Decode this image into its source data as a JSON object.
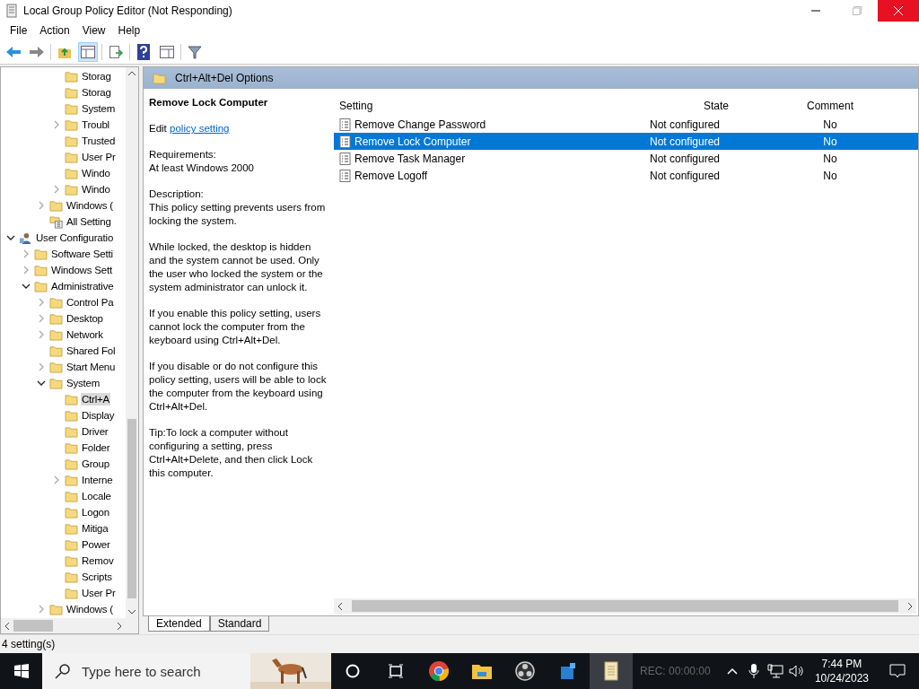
{
  "window": {
    "title": "Local Group Policy Editor (Not Responding)"
  },
  "menu": [
    "File",
    "Action",
    "View",
    "Help"
  ],
  "tree": {
    "items": [
      {
        "children": [
          {
            "children": [
              {
                "children": [
                  {
                    "label": "Storag",
                    "selected": false
                  },
                  {
                    "label": "Storag",
                    "selected": false
                  },
                  {
                    "label": "System",
                    "selected": false
                  },
                  {
                    "label": "Troubl",
                    "expanded": false,
                    "selected": false
                  },
                  {
                    "label": "Trusted",
                    "selected": false
                  },
                  {
                    "label": "User Pr",
                    "selected": false
                  },
                  {
                    "label": "Windo",
                    "selected": false
                  },
                  {
                    "label": "Windo",
                    "expanded": false,
                    "selected": false
                  }
                ]
              },
              {
                "label": "Windows (",
                "expanded": false,
                "selected": false
              },
              {
                "label": "All Setting",
                "kind": "all-settings",
                "selected": false
              }
            ]
          }
        ]
      },
      {
        "label": "User Configuratio",
        "kind": "user",
        "expanded": true,
        "selected": false,
        "children": [
          {
            "label": "Software Setti",
            "expanded": false,
            "selected": false
          },
          {
            "label": "Windows Sett",
            "expanded": false,
            "selected": false
          },
          {
            "label": "Administrative",
            "expanded": true,
            "selected": false,
            "children": [
              {
                "label": "Control Pa",
                "expanded": false,
                "selected": false
              },
              {
                "label": "Desktop",
                "expanded": false,
                "selected": false
              },
              {
                "label": "Network",
                "expanded": false,
                "selected": false
              },
              {
                "label": "Shared Fol",
                "selected": false
              },
              {
                "label": "Start Menu",
                "expanded": false,
                "selected": false
              },
              {
                "label": "System",
                "expanded": true,
                "selected": false,
                "children": [
                  {
                    "label": "Ctrl+A",
                    "selected": true
                  },
                  {
                    "label": "Display",
                    "selected": false
                  },
                  {
                    "label": "Driver",
                    "selected": false
                  },
                  {
                    "label": "Folder",
                    "selected": false
                  },
                  {
                    "label": "Group",
                    "selected": false
                  },
                  {
                    "label": "Interne",
                    "expanded": false,
                    "selected": false
                  },
                  {
                    "label": "Locale",
                    "selected": false
                  },
                  {
                    "label": "Logon",
                    "selected": false
                  },
                  {
                    "label": "Mitiga",
                    "selected": false
                  },
                  {
                    "label": "Power",
                    "selected": false
                  },
                  {
                    "label": "Remov",
                    "selected": false
                  },
                  {
                    "label": "Scripts",
                    "selected": false
                  },
                  {
                    "label": "User Pr",
                    "selected": false
                  }
                ]
              },
              {
                "label": "Windows (",
                "expanded": false,
                "selected": false
              }
            ]
          }
        ]
      }
    ]
  },
  "header": {
    "title": "Ctrl+Alt+Del Options"
  },
  "description": {
    "title": "Remove Lock Computer",
    "edit_prefix": "Edit",
    "edit_link": "policy setting",
    "requirements_label": "Requirements:",
    "requirements": "At least Windows 2000",
    "description_label": "Description:",
    "paragraphs": [
      "This policy setting prevents users from locking the system.",
      "While locked, the desktop is hidden and the system cannot be used. Only the user who locked the system or the system administrator can unlock it.",
      "If you enable this policy setting, users cannot lock the computer from the keyboard using Ctrl+Alt+Del.",
      "If you disable or do not configure this policy setting, users will be able to lock the computer from the keyboard using Ctrl+Alt+Del.",
      "Tip:To lock a computer without configuring a setting, press Ctrl+Alt+Delete, and then click Lock this computer."
    ]
  },
  "table": {
    "columns": [
      "Setting",
      "State",
      "Comment"
    ],
    "rows": [
      {
        "setting": "Remove Change Password",
        "state": "Not configured",
        "comment": "No",
        "selected": false
      },
      {
        "setting": "Remove Lock Computer",
        "state": "Not configured",
        "comment": "No",
        "selected": true
      },
      {
        "setting": "Remove Task Manager",
        "state": "Not configured",
        "comment": "No",
        "selected": false
      },
      {
        "setting": "Remove Logoff",
        "state": "Not configured",
        "comment": "No",
        "selected": false
      }
    ]
  },
  "view_tabs": [
    {
      "label": "Extended",
      "selected": true
    },
    {
      "label": "Standard",
      "selected": false
    }
  ],
  "status_bar": "4 setting(s)",
  "taskbar": {
    "search_placeholder": "Type here to search",
    "overlay_text": "REC: 00:00:00",
    "time": "7:44 PM",
    "date": "10/24/2023"
  }
}
